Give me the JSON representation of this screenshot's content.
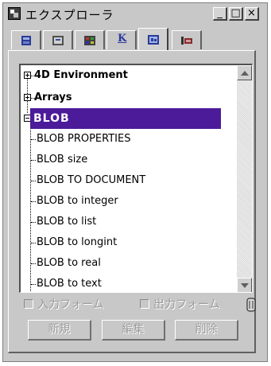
{
  "window": {
    "title": "エクスプローラ"
  },
  "window_controls": {
    "minimize": "_",
    "maximize": "□",
    "close": "×"
  },
  "tabs": [
    {
      "icon": "table-icon"
    },
    {
      "icon": "form-icon"
    },
    {
      "icon": "method-icon"
    },
    {
      "label": "K",
      "icon": "k-letter-icon"
    },
    {
      "icon": "picture-icon",
      "active": true
    },
    {
      "icon": "ruler-icon"
    }
  ],
  "tree": {
    "items": [
      {
        "label": "4D Environment",
        "expander": "+",
        "level": 0,
        "bold": true
      },
      {
        "label": "Arrays",
        "expander": "+",
        "level": 0,
        "bold": true
      },
      {
        "label": "BLOB",
        "expander": "-",
        "level": 0,
        "bold": true,
        "selected": true
      },
      {
        "label": "BLOB PROPERTIES",
        "level": 1
      },
      {
        "label": "BLOB size",
        "level": 1
      },
      {
        "label": "BLOB TO DOCUMENT",
        "level": 1
      },
      {
        "label": "BLOB to integer",
        "level": 1
      },
      {
        "label": "BLOB to list",
        "level": 1
      },
      {
        "label": "BLOB to longint",
        "level": 1
      },
      {
        "label": "BLOB to real",
        "level": 1
      },
      {
        "label": "BLOB to text",
        "level": 1
      }
    ]
  },
  "options": {
    "input_form_label": "入力フォーム",
    "output_form_label": "出力フォーム"
  },
  "buttons": {
    "new": "新規",
    "edit": "編集",
    "delete": "削除"
  },
  "colors": {
    "selection": "#4b1b9a",
    "window_bg": "#c8c8c8",
    "disabled_text": "#9a9a9a"
  }
}
